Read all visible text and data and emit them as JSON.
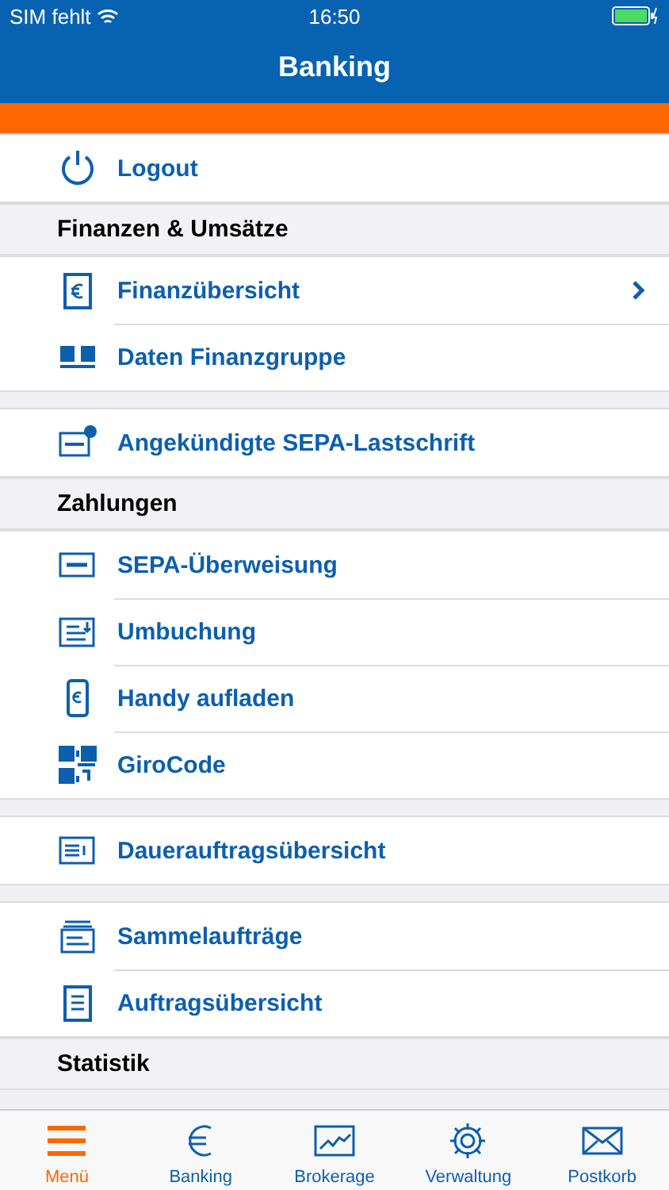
{
  "status_bar": {
    "carrier": "SIM fehlt",
    "time": "16:50"
  },
  "nav": {
    "title": "Banking"
  },
  "groups": [
    {
      "items": [
        {
          "label": "Logout",
          "chevron": false
        }
      ]
    },
    {
      "header": "Finanzen & Umsätze",
      "items": [
        {
          "label": "Finanzübersicht",
          "chevron": true
        },
        {
          "label": "Daten Finanzgruppe",
          "chevron": false
        }
      ]
    },
    {
      "items": [
        {
          "label": "Angekündigte SEPA-Lastschrift",
          "chevron": false
        }
      ]
    },
    {
      "header": "Zahlungen",
      "items": [
        {
          "label": "SEPA-Überweisung",
          "chevron": false
        },
        {
          "label": "Umbuchung",
          "chevron": false
        },
        {
          "label": "Handy aufladen",
          "chevron": false
        },
        {
          "label": "GiroCode",
          "chevron": false
        }
      ]
    },
    {
      "items": [
        {
          "label": "Dauerauftragsübersicht",
          "chevron": false
        }
      ]
    },
    {
      "items": [
        {
          "label": "Sammelaufträge",
          "chevron": false
        },
        {
          "label": "Auftragsübersicht",
          "chevron": false
        }
      ]
    },
    {
      "header": "Statistik"
    }
  ],
  "tab_bar": [
    {
      "label": "Menü",
      "selected": true
    },
    {
      "label": "Banking",
      "selected": false
    },
    {
      "label": "Brokerage",
      "selected": false
    },
    {
      "label": "Verwaltung",
      "selected": false
    },
    {
      "label": "Postkorb",
      "selected": false
    }
  ]
}
